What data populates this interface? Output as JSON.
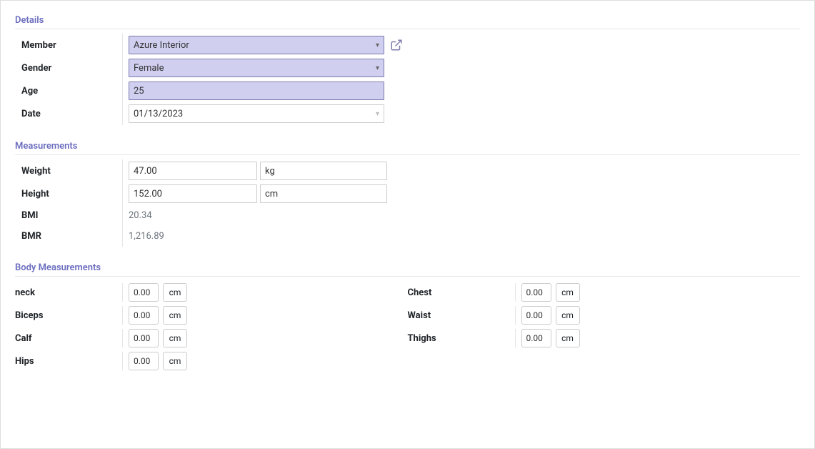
{
  "sections": {
    "details": "Details",
    "measurements": "Measurements",
    "body": "Body Measurements"
  },
  "details": {
    "member_label": "Member",
    "member_value": "Azure Interior",
    "gender_label": "Gender",
    "gender_value": "Female",
    "age_label": "Age",
    "age_value": "25",
    "date_label": "Date",
    "date_value": "01/13/2023"
  },
  "measurements": {
    "weight_label": "Weight",
    "weight_value": "47.00",
    "weight_unit": "kg",
    "height_label": "Height",
    "height_value": "152.00",
    "height_unit": "cm",
    "bmi_label": "BMI",
    "bmi_value": "20.34",
    "bmr_label": "BMR",
    "bmr_value": "1,216.89"
  },
  "body": {
    "neck_label": "neck",
    "neck_value": "0.00",
    "neck_unit": "cm",
    "biceps_label": "Biceps",
    "biceps_value": "0.00",
    "biceps_unit": "cm",
    "calf_label": "Calf",
    "calf_value": "0.00",
    "calf_unit": "cm",
    "hips_label": "Hips",
    "hips_value": "0.00",
    "hips_unit": "cm",
    "chest_label": "Chest",
    "chest_value": "0.00",
    "chest_unit": "cm",
    "waist_label": "Waist",
    "waist_value": "0.00",
    "waist_unit": "cm",
    "thighs_label": "Thighs",
    "thighs_value": "0.00",
    "thighs_unit": "cm"
  }
}
